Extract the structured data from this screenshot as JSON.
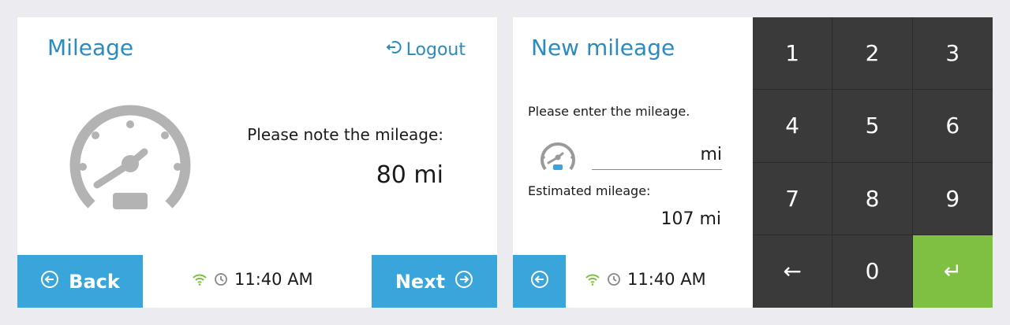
{
  "left_screen": {
    "title": "Mileage",
    "logout_label": "Logout",
    "note_label": "Please note the mileage:",
    "mileage_value": "80 mi",
    "back_label": "Back",
    "next_label": "Next",
    "time": "11:40 AM"
  },
  "right_screen": {
    "title": "New mileage",
    "prompt": "Please enter the mileage.",
    "input_value": "",
    "unit": "mi",
    "estimated_label": "Estimated mileage:",
    "estimated_value": "107 mi",
    "time": "11:40 AM"
  },
  "keypad": {
    "k1": "1",
    "k2": "2",
    "k3": "3",
    "k4": "4",
    "k5": "5",
    "k6": "6",
    "k7": "7",
    "k8": "8",
    "k9": "9",
    "k0": "0",
    "backspace": "←",
    "enter": "↵"
  },
  "colors": {
    "accent_blue": "#3aa5db",
    "title_blue": "#2a8bc0",
    "enter_green": "#7ec142",
    "keypad_dark": "#3a3a3a",
    "wifi_green": "#7ec142",
    "gauge_gray": "#b3b3b3"
  },
  "icons": [
    "logout-icon",
    "speedometer-icon",
    "wifi-icon",
    "clock-icon",
    "back-arrow-icon",
    "next-arrow-icon"
  ]
}
